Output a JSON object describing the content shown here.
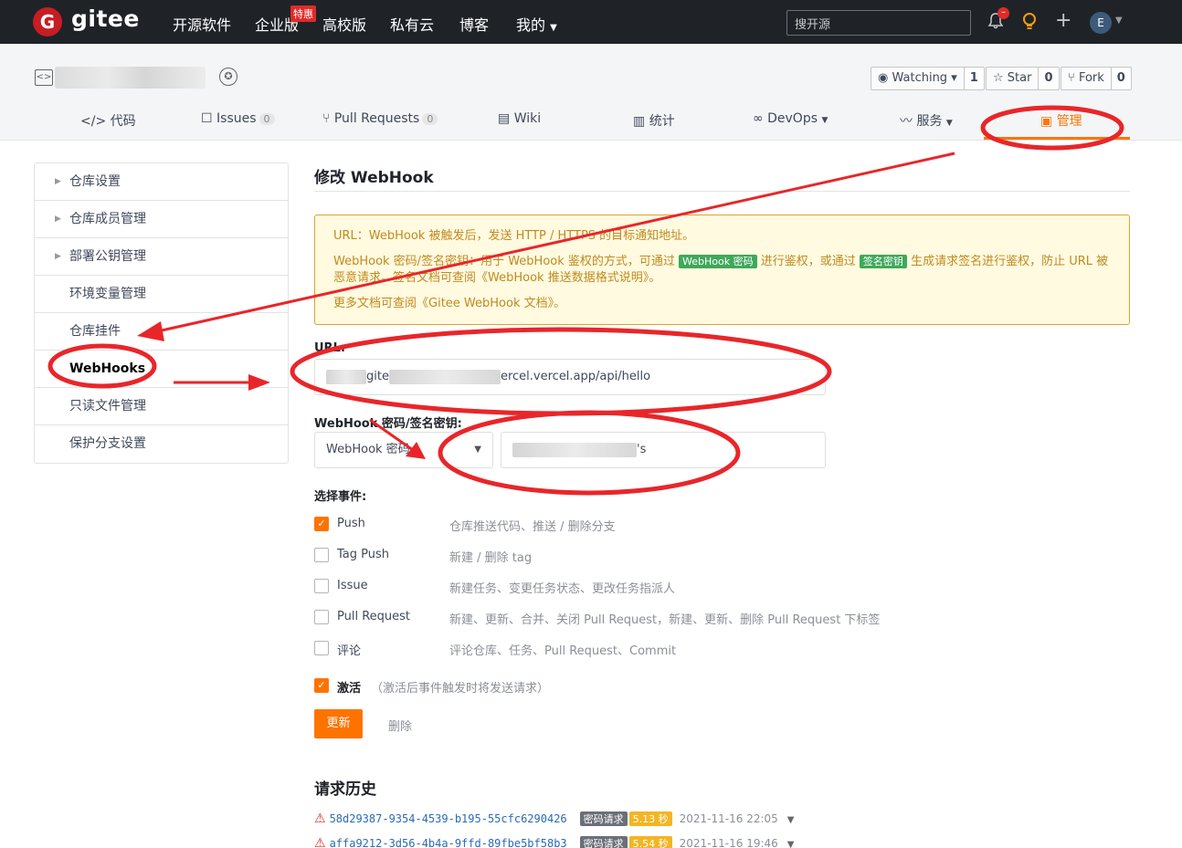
{
  "topnav": {
    "logo_letter": "G",
    "logo_text": "gitee",
    "items": [
      "开源软件",
      "企业版",
      "高校版",
      "私有云",
      "博客",
      "我的"
    ],
    "enterprise_badge": "特惠",
    "search_placeholder": "搜开源",
    "bell_count": "–",
    "avatar_letter": "E"
  },
  "repo": {
    "watch_label": "Watching",
    "watch_count": "1",
    "star_label": "Star",
    "star_count": "0",
    "fork_label": "Fork",
    "fork_count": "0",
    "tabs": [
      {
        "label": "代码"
      },
      {
        "label": "Issues",
        "count": "0"
      },
      {
        "label": "Pull Requests",
        "count": "0"
      },
      {
        "label": "Wiki"
      },
      {
        "label": "统计"
      },
      {
        "label": "DevOps"
      },
      {
        "label": "服务"
      },
      {
        "label": "管理"
      }
    ]
  },
  "sidebar": {
    "items": [
      {
        "label": "仓库设置"
      },
      {
        "label": "仓库成员管理"
      },
      {
        "label": "部署公钥管理"
      },
      {
        "label": "环境变量管理"
      },
      {
        "label": "仓库挂件"
      },
      {
        "label": "WebHooks"
      },
      {
        "label": "只读文件管理"
      },
      {
        "label": "保护分支设置"
      }
    ]
  },
  "main": {
    "title": "修改 WebHook",
    "info": {
      "line1": "URL：WebHook 被触发后，发送 HTTP / HTTPS 的目标通知地址。",
      "line2_a": "WebHook 密码/签名密钥：用于 WebHook 鉴权的方式，可通过",
      "tag_password": "WebHook 密码",
      "line2_b": "进行鉴权，或通过",
      "tag_sign": "签名密钥",
      "line2_c": "生成请求签名进行鉴权，防止 URL 被恶意请求。签名文档可查阅",
      "line2_link": "《WebHook 推送数据格式说明》",
      "line2_end": "。",
      "line3_a": "更多文档可查阅",
      "line3_link": "《Gitee WebHook 文档》",
      "line3_end": "。"
    },
    "url_label": "URL:",
    "url_value_mid": "gite",
    "url_value_end": "ercel.vercel.app/api/hello",
    "secret_label": "WebHook 密码/签名密钥:",
    "secret_type": "WebHook 密码",
    "secret_value_end": "'s",
    "events_label": "选择事件:",
    "events": [
      {
        "name": "Push",
        "desc": "仓库推送代码、推送 / 删除分支",
        "checked": true
      },
      {
        "name": "Tag Push",
        "desc": "新建 / 删除 tag",
        "checked": false
      },
      {
        "name": "Issue",
        "desc": "新建任务、变更任务状态、更改任务指派人",
        "checked": false
      },
      {
        "name": "Pull Request",
        "desc": "新建、更新、合并、关闭 Pull Request，新建、更新、删除 Pull Request 下标签",
        "checked": false
      },
      {
        "name": "评论",
        "desc": "评论仓库、任务、Pull Request、Commit",
        "checked": false
      }
    ],
    "activate_label": "激活",
    "activate_hint": "（激活后事件触发时将发送请求）",
    "update_button": "更新",
    "delete_button": "删除",
    "history_title": "请求历史",
    "history": [
      {
        "id": "58d29387-9354-4539-b195-55cfc6290426",
        "type": "密码请求",
        "duration": "5.13 秒",
        "time": "2021-11-16 22:05"
      },
      {
        "id": "affa9212-3d56-4b4a-9ffd-89fbe5bf58b3",
        "type": "密码请求",
        "duration": "5.54 秒",
        "time": "2021-11-16 19:46"
      }
    ]
  },
  "colors": {
    "accent": "#fe7300",
    "annotation_red": "#e8262a",
    "nav_bg": "#1f2328"
  }
}
